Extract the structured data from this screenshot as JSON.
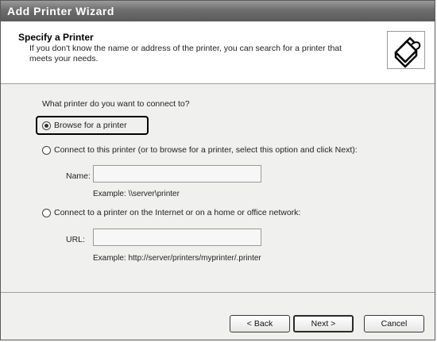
{
  "window": {
    "title": "Add Printer Wizard"
  },
  "header": {
    "title": "Specify a Printer",
    "subtitle": "If you don't know the name or address of the printer, you can search for a printer that meets your needs."
  },
  "main": {
    "question": "What printer do you want to connect to?",
    "options": [
      {
        "label": "Browse for a printer",
        "checked": true
      },
      {
        "label": "Connect to this printer (or to browse for a printer, select this option and click Next):",
        "checked": false
      },
      {
        "label": "Connect to a printer on the Internet or on a home or office network:",
        "checked": false
      }
    ],
    "name_field": {
      "label": "Name:",
      "value": "",
      "example": "Example: \\\\server\\printer"
    },
    "url_field": {
      "label": "URL:",
      "value": "",
      "example": "Example: http://server/printers/myprinter/.printer"
    }
  },
  "footer": {
    "back_label": "< Back",
    "next_label": "Next >",
    "cancel_label": "Cancel"
  },
  "icons": {
    "header_icon": "printer-icon"
  }
}
